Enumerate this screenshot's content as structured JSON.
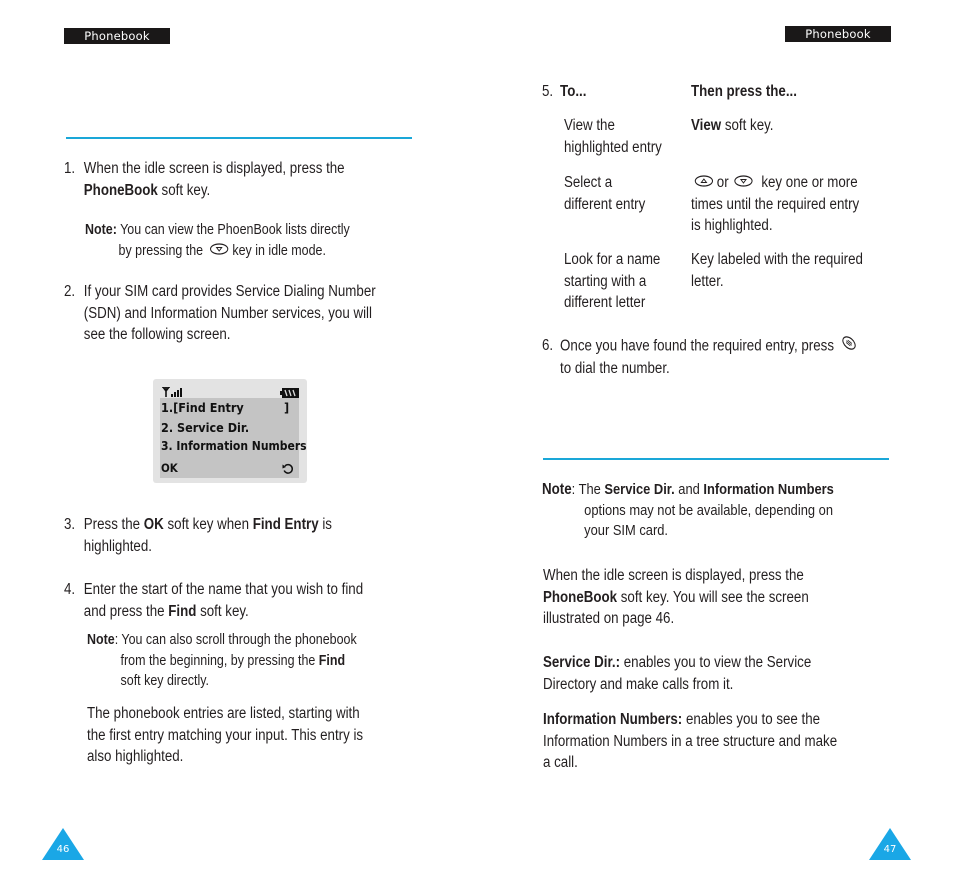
{
  "left_page": {
    "header_tab": "Phonebook",
    "page_number": "46",
    "step1": {
      "num": "1.",
      "line1": "When the idle screen is displayed, press the",
      "bold": "PhoneBook",
      "line2_rest": " soft key."
    },
    "note1": {
      "label": "Note:",
      "line1": " You can view the PhoenBook lists directly",
      "line2_pre": "by pressing the",
      "line2_post": "key in idle mode.",
      "icon": "down-key-icon"
    },
    "step2": {
      "num": "2.",
      "lines": [
        "If your SIM card provides Service Dialing Number",
        "(SDN) and Information Number services, you will",
        "see the following screen."
      ]
    },
    "phone_screen": {
      "status_icons": [
        "signal-strength-icon",
        "battery-icon"
      ],
      "items": [
        "1.[Find Entry",
        "2. Service Dir.",
        "3. Information Numbers"
      ],
      "item1_bracket": "]",
      "softkey_left": "OK",
      "softkey_right_icon": "back-arrow-icon"
    },
    "step3": {
      "num": "3.",
      "t1": "Press the ",
      "b1": "OK",
      "t2": " soft key when ",
      "b2": "Find Entry",
      "t3": " is",
      "line2": "highlighted."
    },
    "step4": {
      "num": "4.",
      "line1": "Enter the start of the name that you wish to find",
      "t1": "and press the ",
      "b1": "Find",
      "t2": " soft key."
    },
    "note2": {
      "label": "Note",
      "line1": ": You can also scroll through the phonebook",
      "line2_pre": "from the beginning, by pressing the ",
      "line2_bold": "Find",
      "line3": "soft key directly."
    },
    "para": {
      "lines": [
        "The phonebook entries are listed, starting with",
        "the first entry matching your input. This entry is",
        "also highlighted."
      ]
    }
  },
  "right_page": {
    "header_tab": "Phonebook",
    "page_number": "47",
    "step5": {
      "num": "5.",
      "col1_header": "To...",
      "col2_header": "Then press the...",
      "rows": [
        {
          "to": [
            "View the",
            "highlighted entry"
          ],
          "press_bold": "View",
          "press_rest": " soft key."
        },
        {
          "to": [
            "Select a",
            "different entry"
          ],
          "press_or": "or",
          "press_line1_rest": "key one or more",
          "press_lines": [
            "times until the required entry",
            "is highlighted."
          ],
          "icons": [
            "up-key-icon",
            "down-key-icon"
          ]
        },
        {
          "to": [
            "Look for a name",
            "starting with a",
            "different letter"
          ],
          "press_lines": [
            "Key labeled with the required",
            "letter."
          ]
        }
      ]
    },
    "step6": {
      "num": "6.",
      "line1": "Once you have found the required entry, press",
      "line2": "to dial the number.",
      "icon": "send-key-icon"
    },
    "note": {
      "label": "Note",
      "t1": ": The ",
      "b1": "Service Dir.",
      "t2": " and ",
      "b2": "Information Numbers",
      "lines": [
        "options may not be available, depending on",
        "your SIM card."
      ]
    },
    "intro": {
      "line1": "When the idle screen is displayed, press the",
      "bold": "PhoneBook",
      "line2_rest": " soft key. You will see the screen",
      "line3": "illustrated on page 46."
    },
    "service_dir": {
      "bold": "Service Dir.:",
      "line1_rest": " enables you to view the Service",
      "line2": "Directory and make calls from it."
    },
    "info_numbers": {
      "bold": "Information Numbers:",
      "line1_rest": " enables you to see the",
      "lines": [
        "Information Numbers in a tree structure and make",
        "a call."
      ]
    }
  },
  "colors": {
    "accent": "#1aa7d8",
    "page_marker": "#1aa7e6",
    "header_tab_bg": "#1a1818",
    "lcd_bg": "#c4c4c4"
  }
}
